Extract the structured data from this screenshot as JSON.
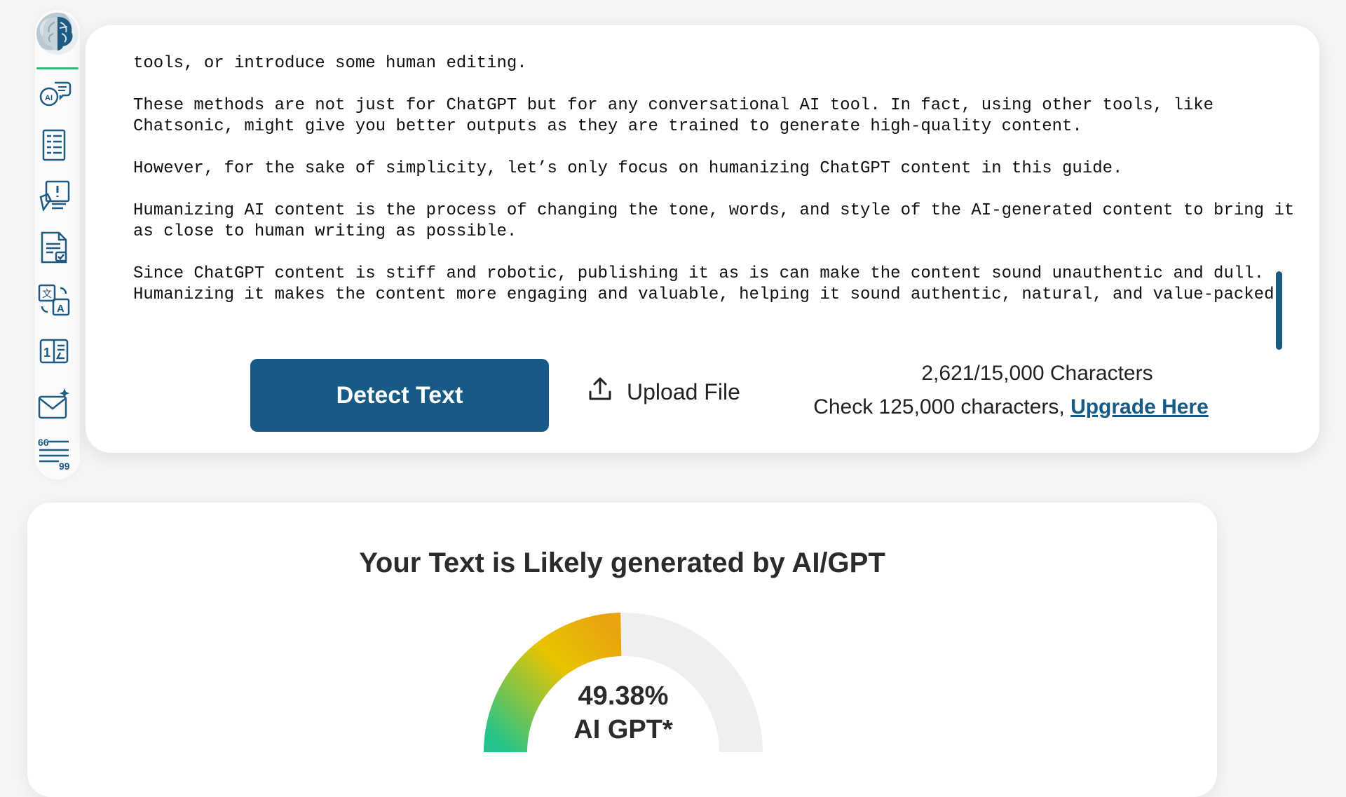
{
  "sidebar": {
    "icons": [
      "brain-logo-icon",
      "ai-chat-icon",
      "document-list-icon",
      "content-tools-icon",
      "document-check-icon",
      "translate-icon",
      "word-counter-icon",
      "email-writer-icon",
      "quote-icon"
    ]
  },
  "editor": {
    "paragraphs": [
      "If you're wondering how to make ChatGPT more human, you need to give it better instructions or prompts, use external tools, or introduce some human editing.",
      "These methods are not just for ChatGPT but for any conversational AI tool. In fact, using other tools, like Chatsonic, might give you better outputs as they are trained to generate high-quality content.",
      "However, for the sake of simplicity, let’s only focus on humanizing ChatGPT content in this guide.",
      "Humanizing AI content is the process of changing the tone, words, and style of the AI-generated content to bring it as close to human writing as possible.",
      "Since ChatGPT content is stiff and robotic, publishing it as is can make the content sound unauthentic and dull. Humanizing it makes the content more engaging and valuable, helping it sound authentic, natural, and value-packed."
    ],
    "detect_label": "Detect Text",
    "upload_label": "Upload File",
    "char_count": "2,621/15,000 Characters",
    "upgrade_prefix": "Check 125,000 characters, ",
    "upgrade_link": "Upgrade Here"
  },
  "result": {
    "title": "Your Text is Likely generated by AI/GPT",
    "percent_text": "49.38%",
    "label": "AI GPT*",
    "ai_percent": 49.38,
    "colors": {
      "start": "#22c48b",
      "mid": "#e8c400",
      "end": "#e8a30f",
      "track": "#efefef"
    }
  }
}
